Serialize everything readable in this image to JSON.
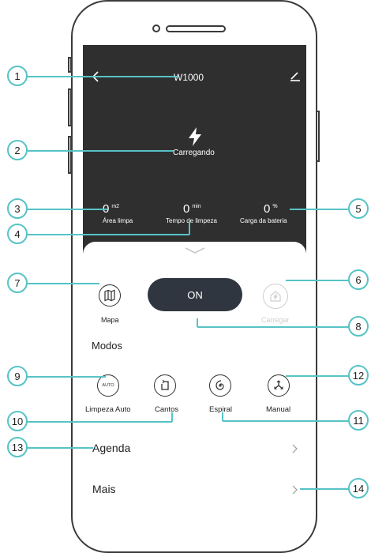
{
  "header": {
    "title": "W1000"
  },
  "status": {
    "text": "Carregando"
  },
  "stats": [
    {
      "value": "0",
      "unit": "m2",
      "label": "Área limpa"
    },
    {
      "value": "0",
      "unit": "min",
      "label": "Tempo de limpeza"
    },
    {
      "value": "0",
      "unit": "%",
      "label": "Carga da bateria"
    }
  ],
  "controls": {
    "map_label": "Mapa",
    "power_label": "ON",
    "charge_label": "Carregar"
  },
  "modes": {
    "title": "Modos",
    "auto_icon_text": "AUTO",
    "items": [
      {
        "label": "Limpeza Auto",
        "icon": "auto-icon"
      },
      {
        "label": "Cantos",
        "icon": "corner-icon"
      },
      {
        "label": "Espiral",
        "icon": "spiral-icon"
      },
      {
        "label": "Manual",
        "icon": "manual-icon"
      }
    ]
  },
  "menu": [
    {
      "label": "Agenda"
    },
    {
      "label": "Mais"
    }
  ],
  "callouts": [
    "1",
    "2",
    "3",
    "4",
    "5",
    "6",
    "7",
    "8",
    "9",
    "10",
    "11",
    "12",
    "13",
    "14"
  ],
  "colors": {
    "accent": "#57c3c6",
    "dark": "#2f2f2f",
    "disabled": "#cfcfcf"
  }
}
